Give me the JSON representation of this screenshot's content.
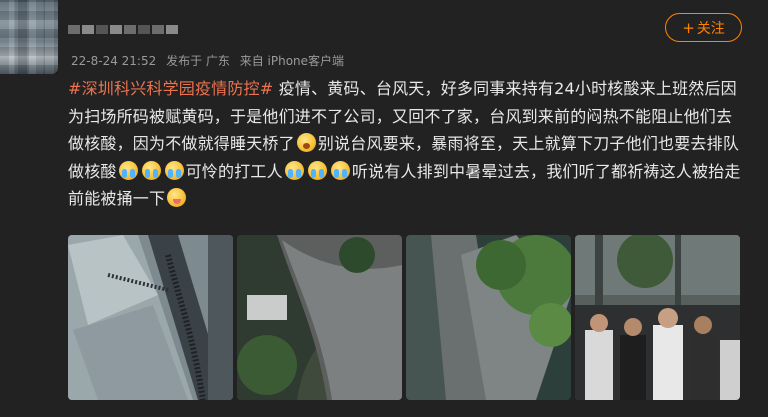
{
  "post": {
    "meta": {
      "time": "22-8-24 21:52",
      "published_in": "发布于 广东",
      "source": "来自 iPhone客户端"
    },
    "follow_label": "关注",
    "follow_icon": "plus-icon",
    "topic": "#深圳科兴科学园疫情防控#",
    "text_1": " 疫情、黄码、台风天，好多同事来持有24小时核酸来上班然后因为扫场所码被赋黄码，于是他们进不了公司，又回不了家，台风到来前的闷热不能阻止他们去做核酸，因为不做就得睡天桥了",
    "text_2": "别说台风要来，暴雨将至，天上就算下刀子他们也要去排队做核酸",
    "text_3": "可怜的打工人",
    "text_4": "听说有人排到中暑晕过去，我们听了都祈祷这人被抬走前能被捅一下",
    "emojis": [
      "yawn-emoji",
      "cry-emoji",
      "tongue-emoji"
    ],
    "photos": [
      "aerial-queue-photo",
      "crowd-courtyard-photo",
      "crowd-under-trees-photo",
      "street-queue-photo"
    ]
  },
  "colors": {
    "accent": "#ff8200",
    "topic": "#eb7350",
    "background": "#222222"
  }
}
